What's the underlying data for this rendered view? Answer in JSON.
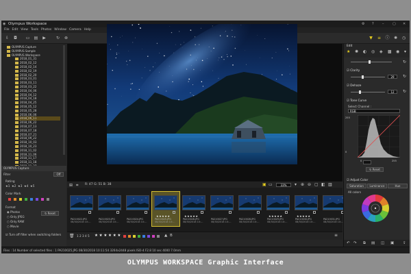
{
  "window": {
    "title": "Olympus Workspace",
    "icon_names": [
      "settings-icon",
      "help-icon",
      "minimize-icon",
      "maximize-icon",
      "close-icon"
    ]
  },
  "menu": [
    "File",
    "Edit",
    "View",
    "Tools",
    "Photos",
    "Window",
    "Camera",
    "Help"
  ],
  "folder_tree": {
    "roots": [
      "OLYMPUS Capture",
      "OLYMPUS Sample",
      "OLYMPUS Workspace"
    ],
    "folders": [
      "2018_01_31",
      "2018_02_12",
      "2018_02_14",
      "2018_02_19",
      "2018_02_20",
      "2018_03_01",
      "2018_03_11",
      "2018_03_22",
      "2018_04_06",
      "2018_04_12",
      "2018_04_18",
      "2018_04_25",
      "2018_05_12",
      "2018_05_28",
      "2018_06_06",
      "2018_06_11",
      "2018_06_22",
      "2018_07_13",
      "2018_07_18",
      "2018_07_21",
      "2018_09_22",
      "2018_10_03",
      "2018_10_23",
      "2018_11_02",
      "2018_11_06",
      "2018_11_17",
      "2018_11_18",
      "2018_11_27",
      "2018_12_10"
    ],
    "selected_index": 15,
    "panel_label": "OLYMPUS Capture"
  },
  "filter": {
    "title": "Filter",
    "toggle_label": "Off",
    "rating_label": "Rating",
    "rating_values": [
      "1",
      "2",
      "3",
      "4",
      "5"
    ],
    "color_mark_label": "Color Mark",
    "color_marks": [
      "#e04040",
      "#e08a2a",
      "#d8d030",
      "#40b040",
      "#3a7ee0",
      "#7a4ae0",
      "#d040c0",
      "#888888"
    ],
    "format_label": "Format",
    "formats": [
      "Photos",
      "Only JPEG",
      "Only RAW",
      "Movie"
    ],
    "reset_label": "Reset",
    "turn_off_label": "Turn off filter when switching folders"
  },
  "viewer": {
    "readout": "R: 47  G: 51  B: 38",
    "zoom": "33%"
  },
  "filmstrip": [
    {
      "name": "PA210022.JPG",
      "date": "08/30/2018 10:…",
      "rating": 0,
      "selected": false
    },
    {
      "name": "PA210023.JPG",
      "date": "08/30/2018 10:…",
      "rating": 0,
      "selected": false
    },
    {
      "name": "PA210024.JPG",
      "date": "08/30/2018 10:…",
      "rating": 0,
      "selected": false
    },
    {
      "name": "PA210025.JPG",
      "date": "08/30/2018 10:…",
      "rating": 5,
      "selected": true
    },
    {
      "name": "PA210026.JPG",
      "date": "08/30/2018 10:…",
      "rating": 5,
      "selected": false
    },
    {
      "name": "PA210027.JPG",
      "date": "08/30/2018 10:…",
      "rating": 0,
      "selected": false
    },
    {
      "name": "PA210028.JPG",
      "date": "08/30/2018 10:…",
      "rating": 0,
      "selected": false
    },
    {
      "name": "PA210029.JPG",
      "date": "08/30/2018 10:…",
      "rating": 5,
      "selected": false
    },
    {
      "name": "PA210030.JPG",
      "date": "08/30/2018 10:…",
      "rating": 5,
      "selected": false
    },
    {
      "name": "PA210031.JPG",
      "date": "08/30/2018 10:…",
      "rating": 0,
      "selected": false
    }
  ],
  "edit_panel": {
    "title": "Edit",
    "clarity_label": "Clarity",
    "clarity_value": "29",
    "dehaze_label": "Dehaze",
    "dehaze_value": "12",
    "tone_curve_label": "Tone Curve",
    "select_channel_label": "Select Channel :",
    "channel": "RGB",
    "curve_in_top": "255",
    "curve_out_top": "0",
    "curve_in_bottom": "0",
    "curve_out_bottom": "255",
    "reset_label": "Reset",
    "adjust_color_label": "Adjust Color",
    "adjust_tabs": [
      "Saturation",
      "Luminance",
      "Hue"
    ],
    "all_colors_label": "All colors"
  },
  "status_bar": "Files : 14  Number of selected files : 1   PA210025.JPG  08/30/2018 10:11:54   3264x2448 pixels  ISO-4  F2.8  10 sec  4000  7.0mm",
  "caption": "OLYMPUS WORKSPACE Graphic Interface"
}
